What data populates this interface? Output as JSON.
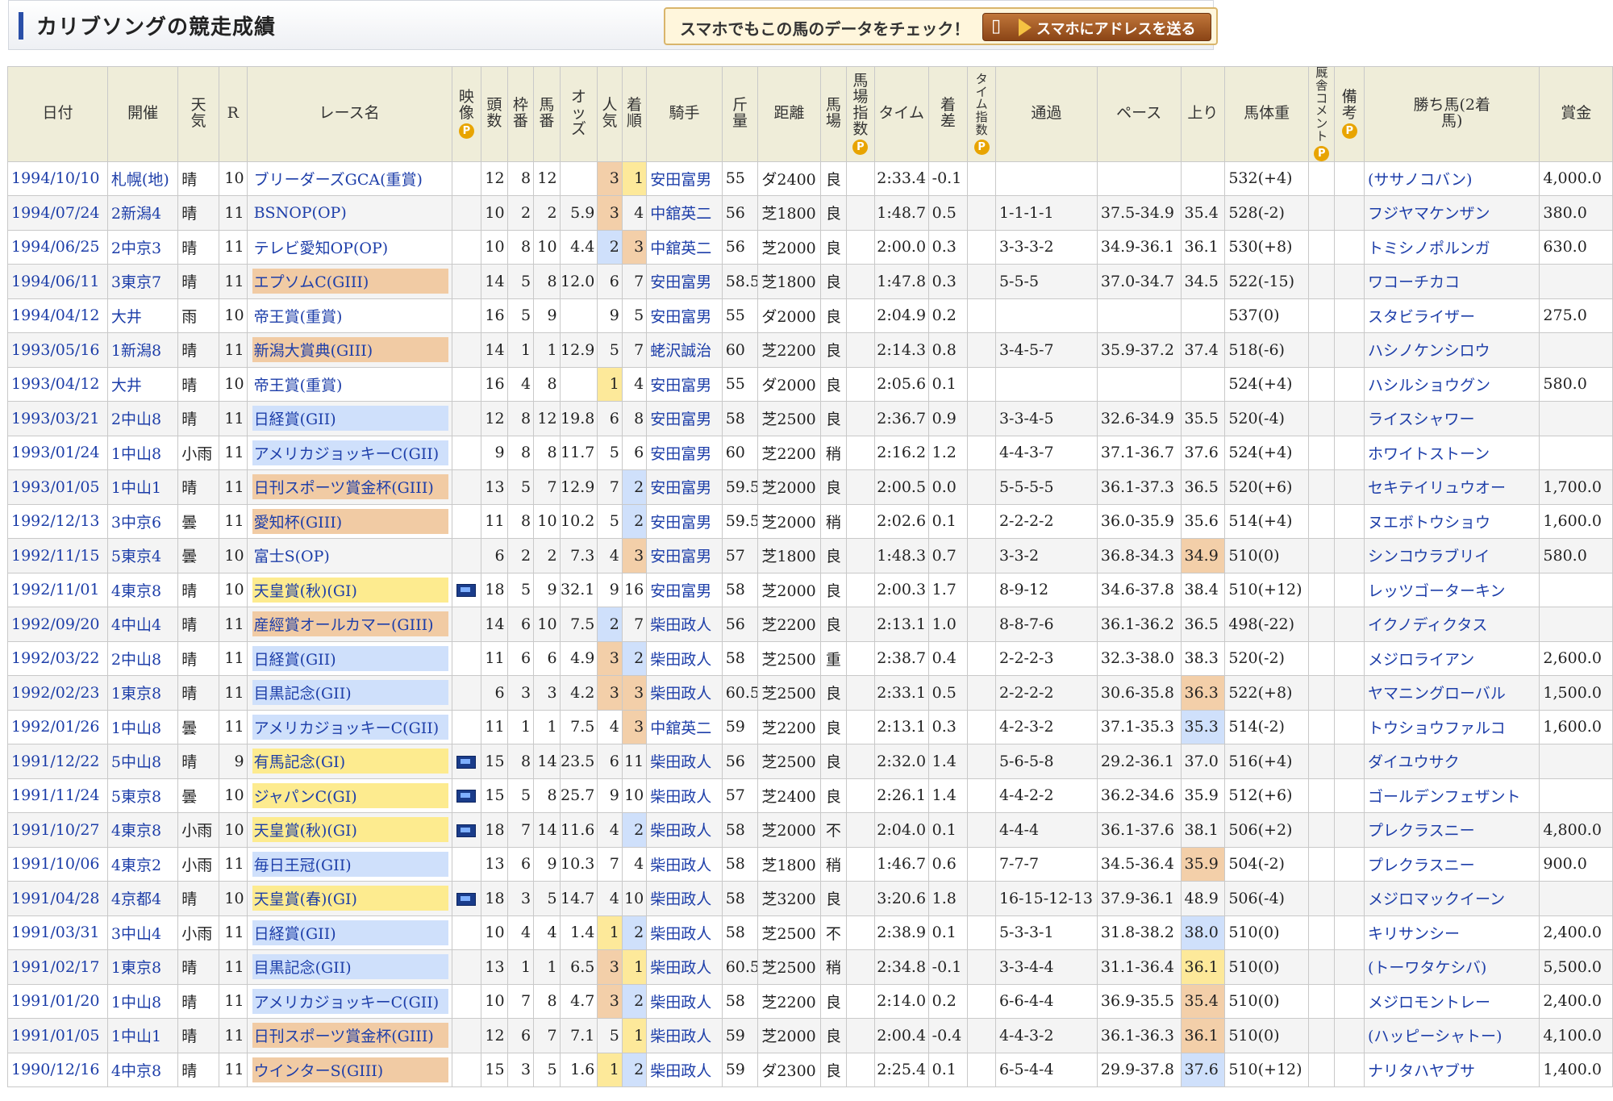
{
  "header": {
    "title": "カリブソングの競走成績",
    "promo_text": "スマホでもこの馬のデータをチェック！",
    "promo_button": "スマホにアドレスを送る"
  },
  "columns": [
    "日付",
    "開催",
    "天気",
    "R",
    "レース名",
    "映像",
    "頭数",
    "枠番",
    "馬番",
    "オッズ",
    "人気",
    "着順",
    "騎手",
    "斤量",
    "距離",
    "馬場",
    "馬場指数",
    "タイム",
    "着差",
    "タイム指数",
    "通過",
    "ペース",
    "上り",
    "馬体重",
    "厩舎コメント",
    "備考",
    "勝ち馬(2着馬)",
    "賞金"
  ],
  "header_labels": {
    "date": "日付",
    "venue": "開催",
    "weather": "天気",
    "r": "R",
    "race": "レース名",
    "video": "映像",
    "heads": "頭数",
    "frame": "枠番",
    "horse_no": "馬番",
    "odds": "オッズ",
    "pop": "人気",
    "finish": "着順",
    "jockey": "騎手",
    "weight": "斤量",
    "dist": "距離",
    "track": "馬場",
    "track_idx": "馬場指数",
    "time": "タイム",
    "margin": "着差",
    "time_idx": "タイム指数",
    "passing": "通過",
    "pace": "ペース",
    "last": "上り",
    "body": "馬体重",
    "comment": "厩舎コメント",
    "note": "備考",
    "winner": "勝ち馬(2着馬)",
    "prize": "賞金"
  },
  "p_badge": "P",
  "rows": [
    {
      "date": "1994/10/10",
      "venue": "札幌(地)",
      "weather": "晴",
      "r": "10",
      "race": "ブリーダーズGCA(重賞)",
      "grade": "",
      "video": false,
      "heads": "12",
      "frame": "8",
      "horse_no": "12",
      "odds": "",
      "pop": "3",
      "pop_hl": "o",
      "finish": "1",
      "fin_hl": "y",
      "jockey": "安田富男",
      "weight": "55",
      "dist": "ダ2400",
      "track": "良",
      "time": "2:33.4",
      "margin": "-0.1",
      "passing": "",
      "pace": "",
      "last": "",
      "last_hl": "",
      "body": "532(+4)",
      "winner": "(ササノコバン)",
      "prize": "4,000.0"
    },
    {
      "date": "1994/07/24",
      "venue": "2新潟4",
      "weather": "晴",
      "r": "11",
      "race": "BSNOP(OP)",
      "grade": "",
      "video": false,
      "heads": "10",
      "frame": "2",
      "horse_no": "2",
      "odds": "5.9",
      "pop": "3",
      "pop_hl": "o",
      "finish": "4",
      "fin_hl": "",
      "jockey": "中舘英二",
      "weight": "56",
      "dist": "芝1800",
      "track": "良",
      "time": "1:48.7",
      "margin": "0.5",
      "passing": "1-1-1-1",
      "pace": "37.5-34.9",
      "last": "35.4",
      "last_hl": "",
      "body": "528(-2)",
      "winner": "フジヤマケンザン",
      "prize": "380.0"
    },
    {
      "date": "1994/06/25",
      "venue": "2中京3",
      "weather": "晴",
      "r": "11",
      "race": "テレビ愛知OP(OP)",
      "grade": "",
      "video": false,
      "heads": "10",
      "frame": "8",
      "horse_no": "10",
      "odds": "4.4",
      "pop": "2",
      "pop_hl": "b",
      "finish": "3",
      "fin_hl": "o",
      "jockey": "中舘英二",
      "weight": "56",
      "dist": "芝2000",
      "track": "良",
      "time": "2:00.0",
      "margin": "0.3",
      "passing": "3-3-3-2",
      "pace": "34.9-36.1",
      "last": "36.1",
      "last_hl": "",
      "body": "530(+8)",
      "winner": "トミシノポルンガ",
      "prize": "630.0"
    },
    {
      "date": "1994/06/11",
      "venue": "3東京7",
      "weather": "晴",
      "r": "11",
      "race": "エプソムC(GIII)",
      "grade": "g3",
      "video": false,
      "heads": "14",
      "frame": "5",
      "horse_no": "8",
      "odds": "12.0",
      "pop": "6",
      "pop_hl": "",
      "finish": "7",
      "fin_hl": "",
      "jockey": "安田富男",
      "weight": "58.5",
      "dist": "芝1800",
      "track": "良",
      "time": "1:47.8",
      "margin": "0.3",
      "passing": "5-5-5",
      "pace": "37.0-34.7",
      "last": "34.5",
      "last_hl": "",
      "body": "522(-15)",
      "winner": "ワコーチカコ",
      "prize": ""
    },
    {
      "date": "1994/04/12",
      "venue": "大井",
      "weather": "雨",
      "r": "10",
      "race": "帝王賞(重賞)",
      "grade": "",
      "video": false,
      "heads": "16",
      "frame": "5",
      "horse_no": "9",
      "odds": "",
      "pop": "9",
      "pop_hl": "",
      "finish": "5",
      "fin_hl": "",
      "jockey": "安田富男",
      "weight": "55",
      "dist": "ダ2000",
      "track": "良",
      "time": "2:04.9",
      "margin": "0.2",
      "passing": "",
      "pace": "",
      "last": "",
      "last_hl": "",
      "body": "537(0)",
      "winner": "スタビライザー",
      "prize": "275.0"
    },
    {
      "date": "1993/05/16",
      "venue": "1新潟8",
      "weather": "晴",
      "r": "11",
      "race": "新潟大賞典(GIII)",
      "grade": "g3",
      "video": false,
      "heads": "14",
      "frame": "1",
      "horse_no": "1",
      "odds": "12.9",
      "pop": "5",
      "pop_hl": "",
      "finish": "7",
      "fin_hl": "",
      "jockey": "蛯沢誠治",
      "weight": "60",
      "dist": "芝2200",
      "track": "良",
      "time": "2:14.3",
      "margin": "0.8",
      "passing": "3-4-5-7",
      "pace": "35.9-37.2",
      "last": "37.4",
      "last_hl": "",
      "body": "518(-6)",
      "winner": "ハシノケンシロウ",
      "prize": ""
    },
    {
      "date": "1993/04/12",
      "venue": "大井",
      "weather": "晴",
      "r": "10",
      "race": "帝王賞(重賞)",
      "grade": "",
      "video": false,
      "heads": "16",
      "frame": "4",
      "horse_no": "8",
      "odds": "",
      "pop": "1",
      "pop_hl": "y",
      "finish": "4",
      "fin_hl": "",
      "jockey": "安田富男",
      "weight": "55",
      "dist": "ダ2000",
      "track": "良",
      "time": "2:05.6",
      "margin": "0.1",
      "passing": "",
      "pace": "",
      "last": "",
      "last_hl": "",
      "body": "524(+4)",
      "winner": "ハシルショウグン",
      "prize": "580.0"
    },
    {
      "date": "1993/03/21",
      "venue": "2中山8",
      "weather": "晴",
      "r": "11",
      "race": "日経賞(GII)",
      "grade": "g2",
      "video": false,
      "heads": "12",
      "frame": "8",
      "horse_no": "12",
      "odds": "19.8",
      "pop": "6",
      "pop_hl": "",
      "finish": "8",
      "fin_hl": "",
      "jockey": "安田富男",
      "weight": "58",
      "dist": "芝2500",
      "track": "良",
      "time": "2:36.7",
      "margin": "0.9",
      "passing": "3-3-4-5",
      "pace": "32.6-34.9",
      "last": "35.5",
      "last_hl": "",
      "body": "520(-4)",
      "winner": "ライスシャワー",
      "prize": ""
    },
    {
      "date": "1993/01/24",
      "venue": "1中山8",
      "weather": "小雨",
      "r": "11",
      "race": "アメリカジョッキーC(GII)",
      "grade": "g2",
      "video": false,
      "heads": "9",
      "frame": "8",
      "horse_no": "8",
      "odds": "11.7",
      "pop": "5",
      "pop_hl": "",
      "finish": "6",
      "fin_hl": "",
      "jockey": "安田富男",
      "weight": "60",
      "dist": "芝2200",
      "track": "稍",
      "time": "2:16.2",
      "margin": "1.2",
      "passing": "4-4-3-7",
      "pace": "37.1-36.7",
      "last": "37.6",
      "last_hl": "",
      "body": "524(+4)",
      "winner": "ホワイトストーン",
      "prize": ""
    },
    {
      "date": "1993/01/05",
      "venue": "1中山1",
      "weather": "晴",
      "r": "11",
      "race": "日刊スポーツ賞金杯(GIII)",
      "grade": "g3",
      "video": false,
      "heads": "13",
      "frame": "5",
      "horse_no": "7",
      "odds": "12.9",
      "pop": "7",
      "pop_hl": "",
      "finish": "2",
      "fin_hl": "b",
      "jockey": "安田富男",
      "weight": "59.5",
      "dist": "芝2000",
      "track": "良",
      "time": "2:00.5",
      "margin": "0.0",
      "passing": "5-5-5-5",
      "pace": "36.1-37.3",
      "last": "36.5",
      "last_hl": "",
      "body": "520(+6)",
      "winner": "セキテイリュウオー",
      "prize": "1,700.0"
    },
    {
      "date": "1992/12/13",
      "venue": "3中京6",
      "weather": "曇",
      "r": "11",
      "race": "愛知杯(GIII)",
      "grade": "g3",
      "video": false,
      "heads": "11",
      "frame": "8",
      "horse_no": "10",
      "odds": "10.2",
      "pop": "5",
      "pop_hl": "",
      "finish": "2",
      "fin_hl": "b",
      "jockey": "安田富男",
      "weight": "59.5",
      "dist": "芝2000",
      "track": "稍",
      "time": "2:02.6",
      "margin": "0.1",
      "passing": "2-2-2-2",
      "pace": "36.0-35.9",
      "last": "35.6",
      "last_hl": "",
      "body": "514(+4)",
      "winner": "ヌエボトウショウ",
      "prize": "1,600.0"
    },
    {
      "date": "1992/11/15",
      "venue": "5東京4",
      "weather": "曇",
      "r": "10",
      "race": "富士S(OP)",
      "grade": "",
      "video": false,
      "heads": "6",
      "frame": "2",
      "horse_no": "2",
      "odds": "7.3",
      "pop": "4",
      "pop_hl": "",
      "finish": "3",
      "fin_hl": "o",
      "jockey": "安田富男",
      "weight": "57",
      "dist": "芝1800",
      "track": "良",
      "time": "1:48.3",
      "margin": "0.7",
      "passing": "3-3-2",
      "pace": "36.8-34.3",
      "last": "34.9",
      "last_hl": "o",
      "body": "510(0)",
      "winner": "シンコウラブリイ",
      "prize": "580.0"
    },
    {
      "date": "1992/11/01",
      "venue": "4東京8",
      "weather": "晴",
      "r": "10",
      "race": "天皇賞(秋)(GI)",
      "grade": "g1",
      "video": true,
      "heads": "18",
      "frame": "5",
      "horse_no": "9",
      "odds": "32.1",
      "pop": "9",
      "pop_hl": "",
      "finish": "16",
      "fin_hl": "",
      "jockey": "安田富男",
      "weight": "58",
      "dist": "芝2000",
      "track": "良",
      "time": "2:00.3",
      "margin": "1.7",
      "passing": "8-9-12",
      "pace": "34.6-37.8",
      "last": "38.4",
      "last_hl": "",
      "body": "510(+12)",
      "winner": "レッツゴーターキン",
      "prize": ""
    },
    {
      "date": "1992/09/20",
      "venue": "4中山4",
      "weather": "晴",
      "r": "11",
      "race": "産經賞オールカマー(GIII)",
      "grade": "g3",
      "video": false,
      "heads": "14",
      "frame": "6",
      "horse_no": "10",
      "odds": "7.5",
      "pop": "2",
      "pop_hl": "b",
      "finish": "7",
      "fin_hl": "",
      "jockey": "柴田政人",
      "weight": "56",
      "dist": "芝2200",
      "track": "良",
      "time": "2:13.1",
      "margin": "1.0",
      "passing": "8-8-7-6",
      "pace": "36.1-36.2",
      "last": "36.5",
      "last_hl": "",
      "body": "498(-22)",
      "winner": "イクノディクタス",
      "prize": ""
    },
    {
      "date": "1992/03/22",
      "venue": "2中山8",
      "weather": "晴",
      "r": "11",
      "race": "日経賞(GII)",
      "grade": "g2",
      "video": false,
      "heads": "11",
      "frame": "6",
      "horse_no": "6",
      "odds": "4.9",
      "pop": "3",
      "pop_hl": "o",
      "finish": "2",
      "fin_hl": "b",
      "jockey": "柴田政人",
      "weight": "58",
      "dist": "芝2500",
      "track": "重",
      "time": "2:38.7",
      "margin": "0.4",
      "passing": "2-2-2-3",
      "pace": "32.3-38.0",
      "last": "38.3",
      "last_hl": "",
      "body": "520(-2)",
      "winner": "メジロライアン",
      "prize": "2,600.0"
    },
    {
      "date": "1992/02/23",
      "venue": "1東京8",
      "weather": "晴",
      "r": "11",
      "race": "目黒記念(GII)",
      "grade": "g2",
      "video": false,
      "heads": "6",
      "frame": "3",
      "horse_no": "3",
      "odds": "4.2",
      "pop": "3",
      "pop_hl": "o",
      "finish": "3",
      "fin_hl": "o",
      "jockey": "柴田政人",
      "weight": "60.5",
      "dist": "芝2500",
      "track": "良",
      "time": "2:33.1",
      "margin": "0.5",
      "passing": "2-2-2-2",
      "pace": "30.6-35.8",
      "last": "36.3",
      "last_hl": "o",
      "body": "522(+8)",
      "winner": "ヤマニングローバル",
      "prize": "1,500.0"
    },
    {
      "date": "1992/01/26",
      "venue": "1中山8",
      "weather": "曇",
      "r": "11",
      "race": "アメリカジョッキーC(GII)",
      "grade": "g2",
      "video": false,
      "heads": "11",
      "frame": "1",
      "horse_no": "1",
      "odds": "7.5",
      "pop": "4",
      "pop_hl": "",
      "finish": "3",
      "fin_hl": "o",
      "jockey": "中舘英二",
      "weight": "59",
      "dist": "芝2200",
      "track": "良",
      "time": "2:13.1",
      "margin": "0.3",
      "passing": "4-2-3-2",
      "pace": "37.1-35.3",
      "last": "35.3",
      "last_hl": "b",
      "body": "514(-2)",
      "winner": "トウショウファルコ",
      "prize": "1,600.0"
    },
    {
      "date": "1991/12/22",
      "venue": "5中山8",
      "weather": "晴",
      "r": "9",
      "race": "有馬記念(GI)",
      "grade": "g1",
      "video": true,
      "heads": "15",
      "frame": "8",
      "horse_no": "14",
      "odds": "23.5",
      "pop": "6",
      "pop_hl": "",
      "finish": "11",
      "fin_hl": "",
      "jockey": "柴田政人",
      "weight": "56",
      "dist": "芝2500",
      "track": "良",
      "time": "2:32.0",
      "margin": "1.4",
      "passing": "5-6-5-8",
      "pace": "29.2-36.1",
      "last": "37.0",
      "last_hl": "",
      "body": "516(+4)",
      "winner": "ダイユウサク",
      "prize": ""
    },
    {
      "date": "1991/11/24",
      "venue": "5東京8",
      "weather": "曇",
      "r": "10",
      "race": "ジャパンC(GI)",
      "grade": "g1",
      "video": true,
      "heads": "15",
      "frame": "5",
      "horse_no": "8",
      "odds": "25.7",
      "pop": "9",
      "pop_hl": "",
      "finish": "10",
      "fin_hl": "",
      "jockey": "柴田政人",
      "weight": "57",
      "dist": "芝2400",
      "track": "良",
      "time": "2:26.1",
      "margin": "1.4",
      "passing": "4-4-2-2",
      "pace": "36.2-34.6",
      "last": "35.9",
      "last_hl": "",
      "body": "512(+6)",
      "winner": "ゴールデンフェザント",
      "prize": ""
    },
    {
      "date": "1991/10/27",
      "venue": "4東京8",
      "weather": "小雨",
      "r": "10",
      "race": "天皇賞(秋)(GI)",
      "grade": "g1",
      "video": true,
      "heads": "18",
      "frame": "7",
      "horse_no": "14",
      "odds": "11.6",
      "pop": "4",
      "pop_hl": "",
      "finish": "2",
      "fin_hl": "b",
      "jockey": "柴田政人",
      "weight": "58",
      "dist": "芝2000",
      "track": "不",
      "time": "2:04.0",
      "margin": "0.1",
      "passing": "4-4-4",
      "pace": "36.1-37.6",
      "last": "38.1",
      "last_hl": "",
      "body": "506(+2)",
      "winner": "プレクラスニー",
      "prize": "4,800.0"
    },
    {
      "date": "1991/10/06",
      "venue": "4東京2",
      "weather": "小雨",
      "r": "11",
      "race": "毎日王冠(GII)",
      "grade": "g2",
      "video": false,
      "heads": "13",
      "frame": "6",
      "horse_no": "9",
      "odds": "10.3",
      "pop": "7",
      "pop_hl": "",
      "finish": "4",
      "fin_hl": "",
      "jockey": "柴田政人",
      "weight": "58",
      "dist": "芝1800",
      "track": "稍",
      "time": "1:46.7",
      "margin": "0.6",
      "passing": "7-7-7",
      "pace": "34.5-36.4",
      "last": "35.9",
      "last_hl": "o",
      "body": "504(-2)",
      "winner": "プレクラスニー",
      "prize": "900.0"
    },
    {
      "date": "1991/04/28",
      "venue": "4京都4",
      "weather": "晴",
      "r": "10",
      "race": "天皇賞(春)(GI)",
      "grade": "g1",
      "video": true,
      "heads": "18",
      "frame": "3",
      "horse_no": "5",
      "odds": "14.7",
      "pop": "4",
      "pop_hl": "",
      "finish": "10",
      "fin_hl": "",
      "jockey": "柴田政人",
      "weight": "58",
      "dist": "芝3200",
      "track": "良",
      "time": "3:20.6",
      "margin": "1.8",
      "passing": "16-15-12-13",
      "pace": "37.9-36.1",
      "last": "48.9",
      "last_hl": "",
      "body": "506(-4)",
      "winner": "メジロマックイーン",
      "prize": ""
    },
    {
      "date": "1991/03/31",
      "venue": "3中山4",
      "weather": "小雨",
      "r": "11",
      "race": "日経賞(GII)",
      "grade": "g2",
      "video": false,
      "heads": "10",
      "frame": "4",
      "horse_no": "4",
      "odds": "1.4",
      "pop": "1",
      "pop_hl": "y",
      "finish": "2",
      "fin_hl": "b",
      "jockey": "柴田政人",
      "weight": "58",
      "dist": "芝2500",
      "track": "不",
      "time": "2:38.9",
      "margin": "0.1",
      "passing": "5-3-3-1",
      "pace": "31.8-38.2",
      "last": "38.0",
      "last_hl": "b",
      "body": "510(0)",
      "winner": "キリサンシー",
      "prize": "2,400.0"
    },
    {
      "date": "1991/02/17",
      "venue": "1東京8",
      "weather": "晴",
      "r": "11",
      "race": "目黒記念(GII)",
      "grade": "g2",
      "video": false,
      "heads": "13",
      "frame": "1",
      "horse_no": "1",
      "odds": "6.5",
      "pop": "3",
      "pop_hl": "o",
      "finish": "1",
      "fin_hl": "y",
      "jockey": "柴田政人",
      "weight": "60.5",
      "dist": "芝2500",
      "track": "稍",
      "time": "2:34.8",
      "margin": "-0.1",
      "passing": "3-3-4-4",
      "pace": "31.1-36.4",
      "last": "36.1",
      "last_hl": "y",
      "body": "510(0)",
      "winner": "(トーワタケシバ)",
      "prize": "5,500.0"
    },
    {
      "date": "1991/01/20",
      "venue": "1中山8",
      "weather": "晴",
      "r": "11",
      "race": "アメリカジョッキーC(GII)",
      "grade": "g2",
      "video": false,
      "heads": "10",
      "frame": "7",
      "horse_no": "8",
      "odds": "4.7",
      "pop": "3",
      "pop_hl": "o",
      "finish": "2",
      "fin_hl": "b",
      "jockey": "柴田政人",
      "weight": "58",
      "dist": "芝2200",
      "track": "良",
      "time": "2:14.0",
      "margin": "0.2",
      "passing": "6-6-4-4",
      "pace": "36.9-35.5",
      "last": "35.4",
      "last_hl": "o",
      "body": "510(0)",
      "winner": "メジロモントレー",
      "prize": "2,400.0"
    },
    {
      "date": "1991/01/05",
      "venue": "1中山1",
      "weather": "晴",
      "r": "11",
      "race": "日刊スポーツ賞金杯(GIII)",
      "grade": "g3",
      "video": false,
      "heads": "12",
      "frame": "6",
      "horse_no": "7",
      "odds": "7.1",
      "pop": "5",
      "pop_hl": "",
      "finish": "1",
      "fin_hl": "y",
      "jockey": "柴田政人",
      "weight": "59",
      "dist": "芝2000",
      "track": "良",
      "time": "2:00.4",
      "margin": "-0.4",
      "passing": "4-4-3-2",
      "pace": "36.1-36.3",
      "last": "36.1",
      "last_hl": "o",
      "body": "510(0)",
      "winner": "(ハッピーシャトー)",
      "prize": "4,100.0"
    },
    {
      "date": "1990/12/16",
      "venue": "4中京8",
      "weather": "晴",
      "r": "11",
      "race": "ウインターS(GIII)",
      "grade": "g3",
      "video": false,
      "heads": "15",
      "frame": "3",
      "horse_no": "5",
      "odds": "1.6",
      "pop": "1",
      "pop_hl": "y",
      "finish": "2",
      "fin_hl": "b",
      "jockey": "柴田政人",
      "weight": "59",
      "dist": "ダ2300",
      "track": "良",
      "time": "2:25.4",
      "margin": "0.1",
      "passing": "6-5-4-4",
      "pace": "29.9-37.8",
      "last": "37.6",
      "last_hl": "b",
      "body": "510(+12)",
      "winner": "ナリタハヤブサ",
      "prize": "1,400.0"
    }
  ]
}
